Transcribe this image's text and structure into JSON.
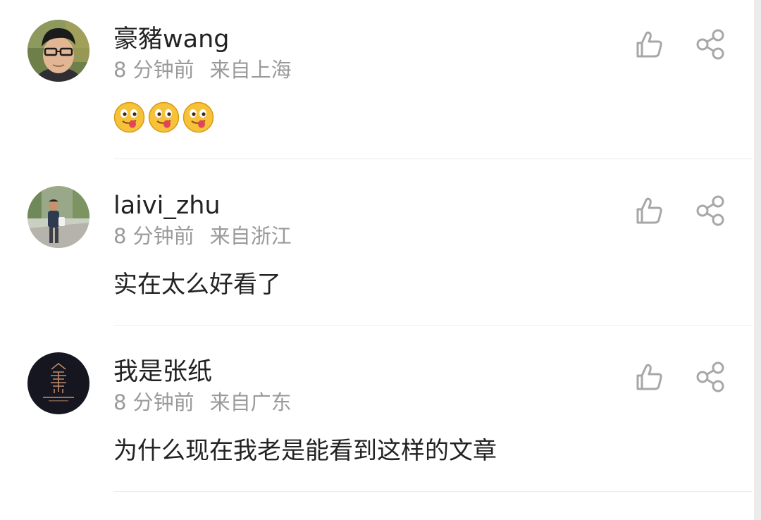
{
  "comments": [
    {
      "username": "豪豬wang",
      "time": "8 分钟前",
      "location": "来自上海",
      "text": "",
      "emojis": [
        "tongue-out-emoji",
        "tongue-out-emoji",
        "tongue-out-emoji"
      ],
      "avatar": "user-photo-glasses"
    },
    {
      "username": "laivi_zhu",
      "time": "8 分钟前",
      "location": "来自浙江",
      "text": "实在太么好看了",
      "emojis": [],
      "avatar": "user-photo-outdoor"
    },
    {
      "username": "我是张纸",
      "time": "8 分钟前",
      "location": "来自广东",
      "text": "为什么现在我老是能看到这样的文章",
      "emojis": [],
      "avatar": "user-logo-dark"
    }
  ],
  "icons": {
    "like": "thumbs-up-icon",
    "share": "share-icon"
  },
  "colors": {
    "username": "#222222",
    "meta": "#9a9a9a",
    "icon": "#a7a7a7",
    "divider": "#ececec"
  }
}
